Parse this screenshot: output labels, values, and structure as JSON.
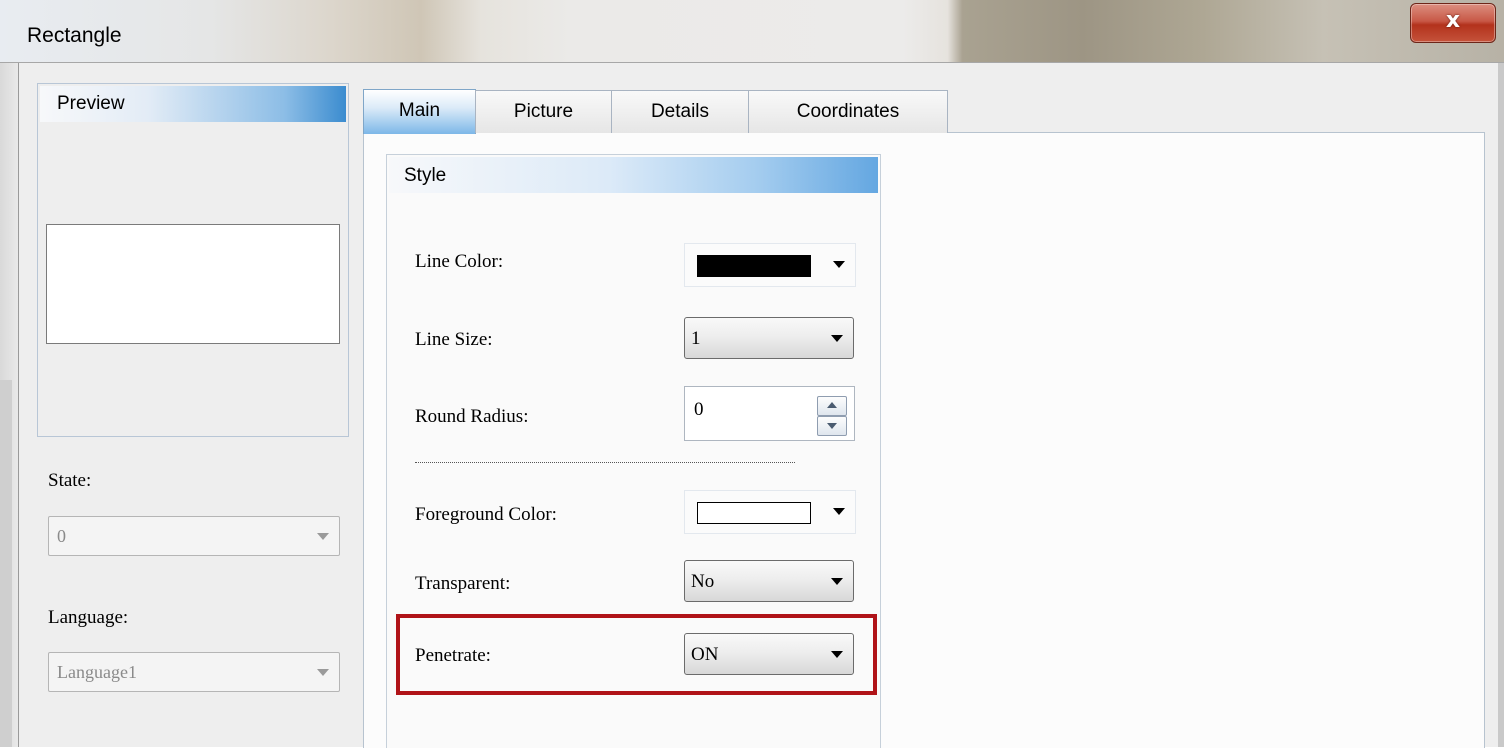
{
  "window": {
    "title": "Rectangle",
    "close_glyph": "x"
  },
  "preview": {
    "title": "Preview"
  },
  "state": {
    "label": "State:",
    "value": "0"
  },
  "language": {
    "label": "Language:",
    "value": "Language1"
  },
  "tabs": [
    {
      "label": "Main",
      "active": true
    },
    {
      "label": "Picture",
      "active": false
    },
    {
      "label": "Details",
      "active": false
    },
    {
      "label": "Coordinates",
      "active": false
    }
  ],
  "style": {
    "title": "Style",
    "line_color": {
      "label": "Line Color:",
      "color": "#000000"
    },
    "line_size": {
      "label": "Line Size:",
      "value": "1"
    },
    "round_radius": {
      "label": "Round Radius:",
      "value": "0"
    },
    "foreground_color": {
      "label": "Foreground Color:",
      "color": "#ffffff"
    },
    "transparent": {
      "label": "Transparent:",
      "value": "No"
    },
    "penetrate": {
      "label": "Penetrate:",
      "value": "ON"
    }
  },
  "colors": {
    "highlight": "#b01318",
    "tab_active": "#7db7e8"
  }
}
